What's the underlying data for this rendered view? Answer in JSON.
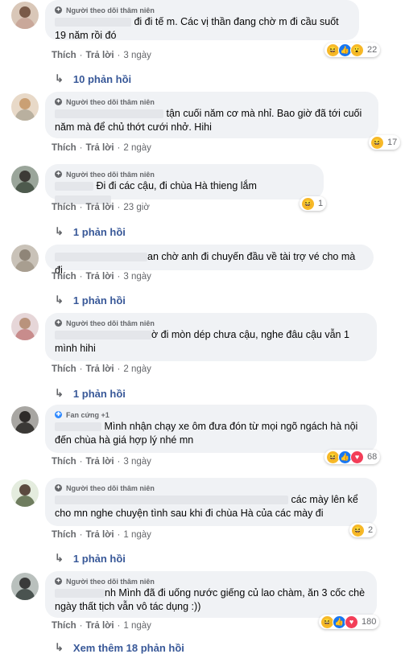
{
  "comments": [
    {
      "badge": "Người theo dõi thâm niên",
      "text": "đi đi tế m. Các vị thần đang chờ m đi cầu suốt 19 năm rồi đó",
      "like": "Thích",
      "reply": "Trả lời",
      "time": "3 ngày",
      "reactions": [
        "haha",
        "like",
        "wow"
      ],
      "count": "22",
      "replies_label": "10 phản hồi"
    },
    {
      "badge": "Người theo dõi thâm niên",
      "text": "tận cuối năm cơ mà nhỉ. Bao giờ đã tới cuối năm mà để chủ thớt cưới nhở. Hihi",
      "like": "Thích",
      "reply": "Trả lời",
      "time": "2 ngày",
      "reactions": [
        "haha"
      ],
      "count": "17",
      "replies_label": ""
    },
    {
      "badge": "Người theo dõi thâm niên",
      "text": "Đi đi các cậu, đi chùa Hà thieng lắm",
      "like": "Thích",
      "reply": "Trả lời",
      "time": "23 giờ",
      "reactions": [
        "haha"
      ],
      "count": "1",
      "replies_label": "1 phản hồi"
    },
    {
      "badge": "",
      "text": "an chờ anh đi chuyến đầu về tài trợ vé cho mà đi",
      "like": "Thích",
      "reply": "Trả lời",
      "time": "3 ngày",
      "reactions": [],
      "count": "",
      "replies_label": "1 phản hồi"
    },
    {
      "badge": "Người theo dõi thâm niên",
      "text": "ờ đi mòn dép chưa cậu, nghe đâu cậu vẫn 1 mình hihi",
      "like": "Thích",
      "reply": "Trả lời",
      "time": "2 ngày",
      "reactions": [],
      "count": "",
      "replies_label": "1 phản hồi"
    },
    {
      "badge": "Fan cứng +1",
      "text": "Mình nhận chạy xe ôm đưa đón từ mọi ngõ ngách hà nội đến chùa hà giá hợp lý nhé mn",
      "like": "Thích",
      "reply": "Trả lời",
      "time": "3 ngày",
      "reactions": [
        "haha",
        "like",
        "love"
      ],
      "count": "68",
      "replies_label": ""
    },
    {
      "badge": "Người theo dõi thâm niên",
      "text": "các mày lên kể cho mn nghe chuyện tình sau khi đi chùa Hà của các mày đi",
      "like": "Thích",
      "reply": "Trả lời",
      "time": "1 ngày",
      "reactions": [
        "haha"
      ],
      "count": "2",
      "replies_label": "1 phản hồi"
    },
    {
      "badge": "Người theo dõi thâm niên",
      "text": "nh Mình đã đi uống nước giếng củ lao chàm, ăn 3 cốc chè ngày thất tịch vẫn vô tác dụng :))",
      "like": "Thích",
      "reply": "Trả lời",
      "time": "1 ngày",
      "reactions": [
        "haha",
        "like",
        "love"
      ],
      "count": "180",
      "replies_label": "Xem thêm 18 phản hồi"
    }
  ]
}
